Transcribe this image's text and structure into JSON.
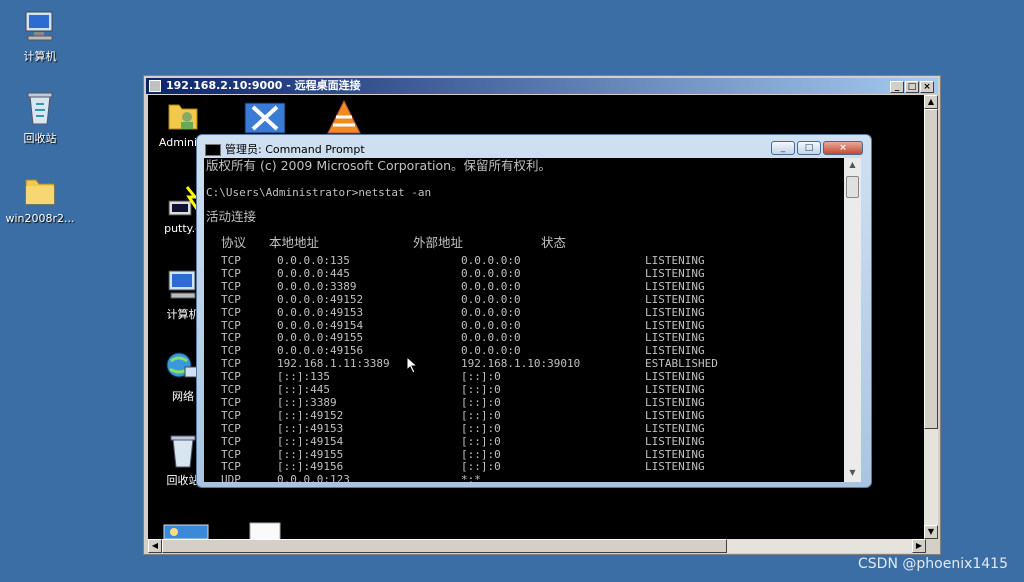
{
  "desktop_icons": [
    {
      "label": "计算机",
      "icon": "computer-icon"
    },
    {
      "label": "回收站",
      "icon": "recycle-bin-icon"
    },
    {
      "label": "win2008r2...",
      "icon": "folder-icon"
    }
  ],
  "rdp": {
    "title": "192.168.2.10:9000 - 远程桌面连接",
    "btn_min": "_",
    "btn_max": "□",
    "btn_close": "×"
  },
  "inner_icons": [
    {
      "label": "Administ",
      "icon": "user-folder-icon"
    },
    {
      "label": "putty.e",
      "icon": "putty-icon"
    },
    {
      "label": "计算机",
      "icon": "computer-icon"
    },
    {
      "label": "网络",
      "icon": "network-icon"
    },
    {
      "label": "回收站",
      "icon": "recycle-bin-icon"
    }
  ],
  "cmd": {
    "title": "管理员: Command Prompt",
    "copyright": "版权所有 (c) 2009 Microsoft Corporation。保留所有权利。",
    "prompt": "C:\\Users\\Administrator>netstat -an",
    "section": "活动连接",
    "headers": {
      "proto": "协议",
      "local": "本地地址",
      "foreign": "外部地址",
      "state": "状态"
    },
    "rows": [
      {
        "proto": "TCP",
        "local": "0.0.0.0:135",
        "foreign": "0.0.0.0:0",
        "state": "LISTENING"
      },
      {
        "proto": "TCP",
        "local": "0.0.0.0:445",
        "foreign": "0.0.0.0:0",
        "state": "LISTENING"
      },
      {
        "proto": "TCP",
        "local": "0.0.0.0:3389",
        "foreign": "0.0.0.0:0",
        "state": "LISTENING"
      },
      {
        "proto": "TCP",
        "local": "0.0.0.0:49152",
        "foreign": "0.0.0.0:0",
        "state": "LISTENING"
      },
      {
        "proto": "TCP",
        "local": "0.0.0.0:49153",
        "foreign": "0.0.0.0:0",
        "state": "LISTENING"
      },
      {
        "proto": "TCP",
        "local": "0.0.0.0:49154",
        "foreign": "0.0.0.0:0",
        "state": "LISTENING"
      },
      {
        "proto": "TCP",
        "local": "0.0.0.0:49155",
        "foreign": "0.0.0.0:0",
        "state": "LISTENING"
      },
      {
        "proto": "TCP",
        "local": "0.0.0.0:49156",
        "foreign": "0.0.0.0:0",
        "state": "LISTENING"
      },
      {
        "proto": "TCP",
        "local": "192.168.1.11:3389",
        "foreign": "192.168.1.10:39010",
        "state": "ESTABLISHED"
      },
      {
        "proto": "TCP",
        "local": "[::]:135",
        "foreign": "[::]:0",
        "state": "LISTENING"
      },
      {
        "proto": "TCP",
        "local": "[::]:445",
        "foreign": "[::]:0",
        "state": "LISTENING"
      },
      {
        "proto": "TCP",
        "local": "[::]:3389",
        "foreign": "[::]:0",
        "state": "LISTENING"
      },
      {
        "proto": "TCP",
        "local": "[::]:49152",
        "foreign": "[::]:0",
        "state": "LISTENING"
      },
      {
        "proto": "TCP",
        "local": "[::]:49153",
        "foreign": "[::]:0",
        "state": "LISTENING"
      },
      {
        "proto": "TCP",
        "local": "[::]:49154",
        "foreign": "[::]:0",
        "state": "LISTENING"
      },
      {
        "proto": "TCP",
        "local": "[::]:49155",
        "foreign": "[::]:0",
        "state": "LISTENING"
      },
      {
        "proto": "TCP",
        "local": "[::]:49156",
        "foreign": "[::]:0",
        "state": "LISTENING"
      },
      {
        "proto": "UDP",
        "local": "0.0.0.0:123",
        "foreign": "*:*",
        "state": ""
      }
    ]
  },
  "watermark": "CSDN @phoenix1415",
  "colors": {
    "desktop": "#3a6ea5",
    "console_bg": "#000000",
    "console_text": "#c0c0c0"
  }
}
